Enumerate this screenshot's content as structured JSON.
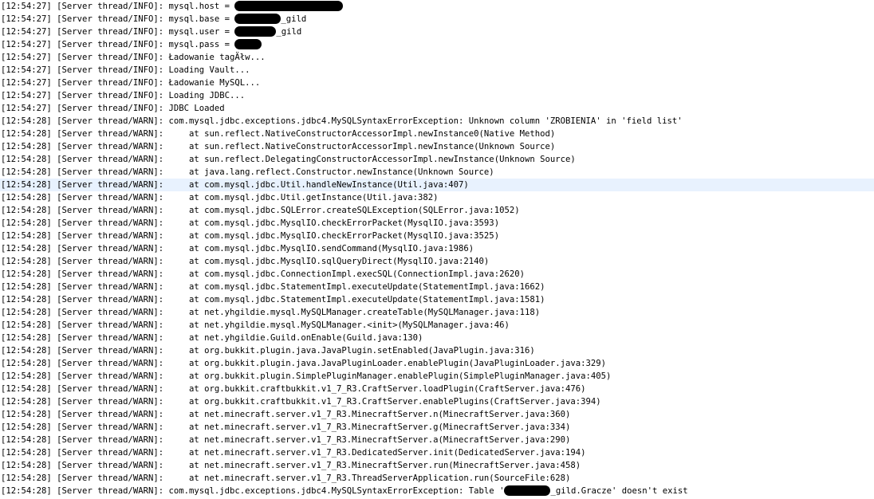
{
  "console": {
    "lines": [
      {
        "ts": "[12:54:27]",
        "src": "[Server thread/INFO]:",
        "pre": "mysql.host = ",
        "redacted": "host",
        "post": ""
      },
      {
        "ts": "[12:54:27]",
        "src": "[Server thread/INFO]:",
        "pre": "mysql.base = ",
        "redacted": "base",
        "post": "_gild"
      },
      {
        "ts": "[12:54:27]",
        "src": "[Server thread/INFO]:",
        "pre": "mysql.user = ",
        "redacted": "user",
        "post": "_gild"
      },
      {
        "ts": "[12:54:27]",
        "src": "[Server thread/INFO]:",
        "pre": "mysql.pass = ",
        "redacted": "pass",
        "post": ""
      },
      {
        "ts": "[12:54:27]",
        "src": "[Server thread/INFO]:",
        "pre": "Ładowanie tagÄłw..."
      },
      {
        "ts": "[12:54:27]",
        "src": "[Server thread/INFO]:",
        "pre": "Loading Vault..."
      },
      {
        "ts": "[12:54:27]",
        "src": "[Server thread/INFO]:",
        "pre": "Ładowanie MySQL..."
      },
      {
        "ts": "[12:54:27]",
        "src": "[Server thread/INFO]:",
        "pre": "Loading JDBC..."
      },
      {
        "ts": "[12:54:27]",
        "src": "[Server thread/INFO]:",
        "pre": "JDBC Loaded"
      },
      {
        "ts": "[12:54:28]",
        "src": "[Server thread/WARN]:",
        "pre": "com.mysql.jdbc.exceptions.jdbc4.MySQLSyntaxErrorException: Unknown column 'ZROBIENIA' in 'field list'"
      },
      {
        "ts": "[12:54:28]",
        "src": "[Server thread/WARN]:",
        "pre": "    at sun.reflect.NativeConstructorAccessorImpl.newInstance0(Native Method)"
      },
      {
        "ts": "[12:54:28]",
        "src": "[Server thread/WARN]:",
        "pre": "    at sun.reflect.NativeConstructorAccessorImpl.newInstance(Unknown Source)"
      },
      {
        "ts": "[12:54:28]",
        "src": "[Server thread/WARN]:",
        "pre": "    at sun.reflect.DelegatingConstructorAccessorImpl.newInstance(Unknown Source)"
      },
      {
        "ts": "[12:54:28]",
        "src": "[Server thread/WARN]:",
        "pre": "    at java.lang.reflect.Constructor.newInstance(Unknown Source)"
      },
      {
        "ts": "[12:54:28]",
        "src": "[Server thread/WARN]:",
        "pre": "    at com.mysql.jdbc.Util.handleNewInstance(Util.java:407)",
        "selected": true
      },
      {
        "ts": "[12:54:28]",
        "src": "[Server thread/WARN]:",
        "pre": "    at com.mysql.jdbc.Util.getInstance(Util.java:382)"
      },
      {
        "ts": "[12:54:28]",
        "src": "[Server thread/WARN]:",
        "pre": "    at com.mysql.jdbc.SQLError.createSQLException(SQLError.java:1052)"
      },
      {
        "ts": "[12:54:28]",
        "src": "[Server thread/WARN]:",
        "pre": "    at com.mysql.jdbc.MysqlIO.checkErrorPacket(MysqlIO.java:3593)"
      },
      {
        "ts": "[12:54:28]",
        "src": "[Server thread/WARN]:",
        "pre": "    at com.mysql.jdbc.MysqlIO.checkErrorPacket(MysqlIO.java:3525)"
      },
      {
        "ts": "[12:54:28]",
        "src": "[Server thread/WARN]:",
        "pre": "    at com.mysql.jdbc.MysqlIO.sendCommand(MysqlIO.java:1986)"
      },
      {
        "ts": "[12:54:28]",
        "src": "[Server thread/WARN]:",
        "pre": "    at com.mysql.jdbc.MysqlIO.sqlQueryDirect(MysqlIO.java:2140)"
      },
      {
        "ts": "[12:54:28]",
        "src": "[Server thread/WARN]:",
        "pre": "    at com.mysql.jdbc.ConnectionImpl.execSQL(ConnectionImpl.java:2620)"
      },
      {
        "ts": "[12:54:28]",
        "src": "[Server thread/WARN]:",
        "pre": "    at com.mysql.jdbc.StatementImpl.executeUpdate(StatementImpl.java:1662)"
      },
      {
        "ts": "[12:54:28]",
        "src": "[Server thread/WARN]:",
        "pre": "    at com.mysql.jdbc.StatementImpl.executeUpdate(StatementImpl.java:1581)"
      },
      {
        "ts": "[12:54:28]",
        "src": "[Server thread/WARN]:",
        "pre": "    at net.yhgildie.mysql.MySQLManager.createTable(MySQLManager.java:118)"
      },
      {
        "ts": "[12:54:28]",
        "src": "[Server thread/WARN]:",
        "pre": "    at net.yhgildie.mysql.MySQLManager.<init>(MySQLManager.java:46)"
      },
      {
        "ts": "[12:54:28]",
        "src": "[Server thread/WARN]:",
        "pre": "    at net.yhgildie.Guild.onEnable(Guild.java:130)"
      },
      {
        "ts": "[12:54:28]",
        "src": "[Server thread/WARN]:",
        "pre": "    at org.bukkit.plugin.java.JavaPlugin.setEnabled(JavaPlugin.java:316)"
      },
      {
        "ts": "[12:54:28]",
        "src": "[Server thread/WARN]:",
        "pre": "    at org.bukkit.plugin.java.JavaPluginLoader.enablePlugin(JavaPluginLoader.java:329)"
      },
      {
        "ts": "[12:54:28]",
        "src": "[Server thread/WARN]:",
        "pre": "    at org.bukkit.plugin.SimplePluginManager.enablePlugin(SimplePluginManager.java:405)"
      },
      {
        "ts": "[12:54:28]",
        "src": "[Server thread/WARN]:",
        "pre": "    at org.bukkit.craftbukkit.v1_7_R3.CraftServer.loadPlugin(CraftServer.java:476)"
      },
      {
        "ts": "[12:54:28]",
        "src": "[Server thread/WARN]:",
        "pre": "    at org.bukkit.craftbukkit.v1_7_R3.CraftServer.enablePlugins(CraftServer.java:394)"
      },
      {
        "ts": "[12:54:28]",
        "src": "[Server thread/WARN]:",
        "pre": "    at net.minecraft.server.v1_7_R3.MinecraftServer.n(MinecraftServer.java:360)"
      },
      {
        "ts": "[12:54:28]",
        "src": "[Server thread/WARN]:",
        "pre": "    at net.minecraft.server.v1_7_R3.MinecraftServer.g(MinecraftServer.java:334)"
      },
      {
        "ts": "[12:54:28]",
        "src": "[Server thread/WARN]:",
        "pre": "    at net.minecraft.server.v1_7_R3.MinecraftServer.a(MinecraftServer.java:290)"
      },
      {
        "ts": "[12:54:28]",
        "src": "[Server thread/WARN]:",
        "pre": "    at net.minecraft.server.v1_7_R3.DedicatedServer.init(DedicatedServer.java:194)"
      },
      {
        "ts": "[12:54:28]",
        "src": "[Server thread/WARN]:",
        "pre": "    at net.minecraft.server.v1_7_R3.MinecraftServer.run(MinecraftServer.java:458)"
      },
      {
        "ts": "[12:54:28]",
        "src": "[Server thread/WARN]:",
        "pre": "    at net.minecraft.server.v1_7_R3.ThreadServerApplication.run(SourceFile:628)"
      },
      {
        "ts": "[12:54:28]",
        "src": "[Server thread/WARN]:",
        "pre": "com.mysql.jdbc.exceptions.jdbc4.MySQLSyntaxErrorException: Table '",
        "redacted": "table",
        "post": "_gild.Gracze' doesn't exist"
      }
    ]
  }
}
